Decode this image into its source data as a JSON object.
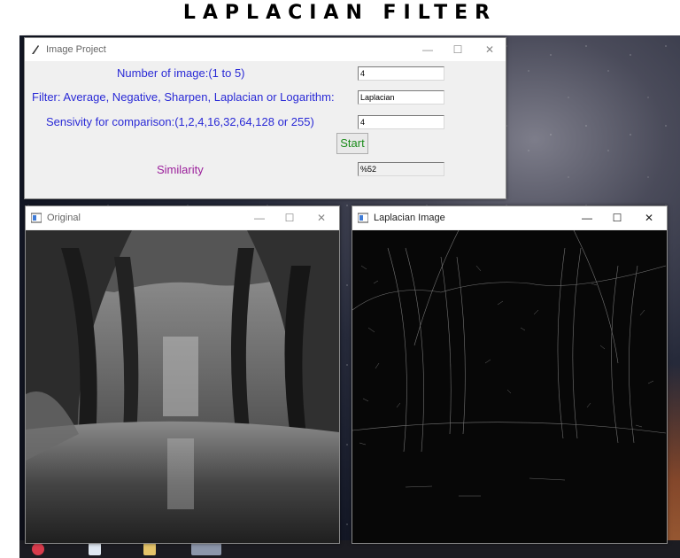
{
  "heading": "LAPLACIAN FILTER",
  "project_window": {
    "title": "Image Project",
    "rows": [
      {
        "label": "Number of image:(1 to 5)",
        "value": "4",
        "label_color": "#2a2ad6"
      },
      {
        "label": "Filter: Average, Negative, Sharpen, Laplacian or Logarithm:",
        "value": "Laplacian",
        "label_color": "#2a2ad6"
      },
      {
        "label": "Sensivity for comparison:(1,2,4,16,32,64,128 or 255)",
        "value": "4",
        "label_color": "#2a2ad6"
      }
    ],
    "start_label": "Start",
    "similarity_label": "Similarity",
    "similarity_value": "%52",
    "similarity_color": "#9b1f9b"
  },
  "original_window": {
    "title": "Original"
  },
  "laplacian_window": {
    "title": "Laplacian Image"
  },
  "window_controls": {
    "minimize": "—",
    "maximize": "☐",
    "close": "✕"
  },
  "icons": [
    "feather-icon",
    "image-window-icon",
    "minimize-icon",
    "maximize-icon",
    "close-icon"
  ]
}
